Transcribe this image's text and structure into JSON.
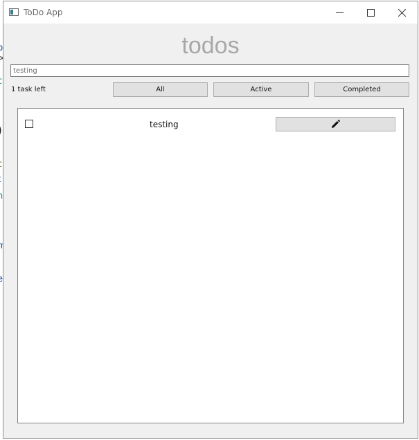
{
  "window": {
    "title": "ToDo App"
  },
  "app": {
    "heading": "todos",
    "new_todo_value": "testing",
    "tasks_left": "1 task left"
  },
  "filters": {
    "all": "All",
    "active": "Active",
    "completed": "Completed"
  },
  "todos": [
    {
      "text": "testing",
      "completed": false
    }
  ],
  "icons": {
    "edit": "pencil-icon",
    "app": "window-app-icon"
  }
}
